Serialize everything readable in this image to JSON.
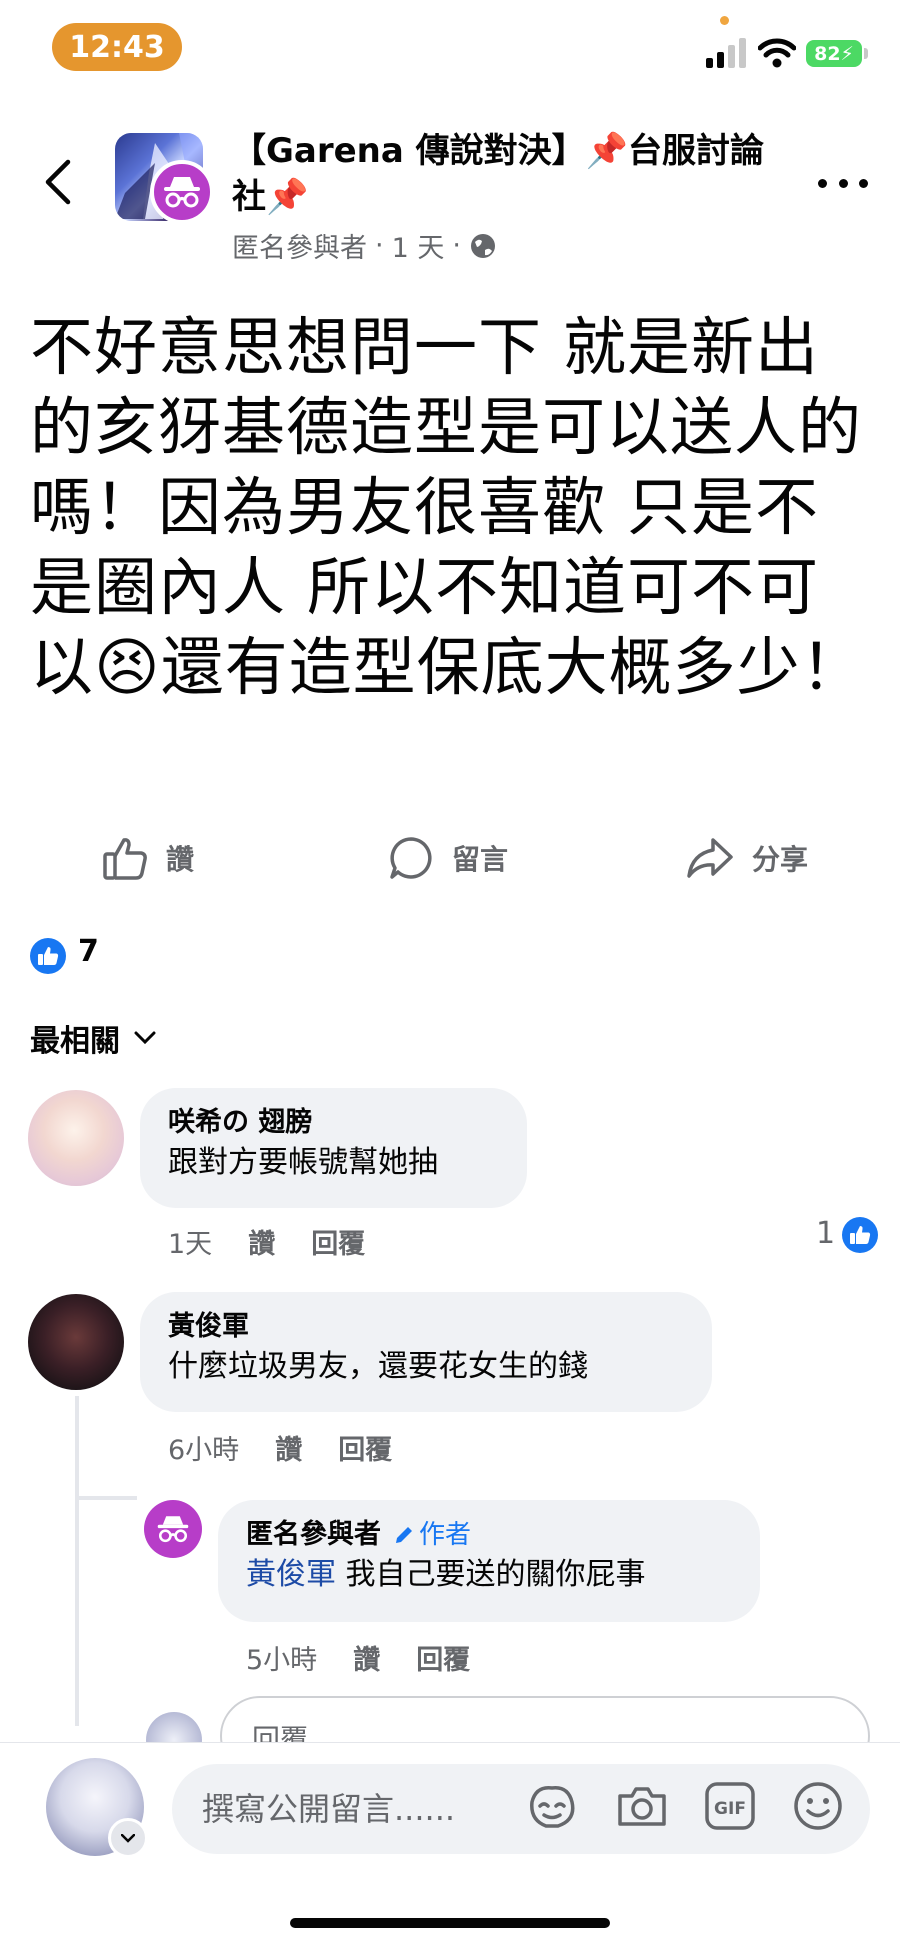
{
  "status_bar": {
    "time": "12:43",
    "battery": "82"
  },
  "header": {
    "group_name": "【Garena 傳說對決】📌台服討論社📌",
    "author": "匿名參與者",
    "time": "1 天"
  },
  "post": {
    "body": "不好意思想問一下 就是新出的亥犽基德造型是可以送人的嗎！因為男友很喜歡 只是不是圈內人 所以不知道可不可以😣還有造型保底大概多少！"
  },
  "actions": {
    "like": "讚",
    "comment": "留言",
    "share": "分享"
  },
  "reactions": {
    "count": "7"
  },
  "sort": {
    "label": "最相關"
  },
  "comments": [
    {
      "name": "咲希の 翅膀",
      "text": "跟對方要帳號幫她抽",
      "time": "1天",
      "like": "讚",
      "reply": "回覆",
      "like_count": "1"
    },
    {
      "name": "黃俊軍",
      "text": "什麼垃圾男友，還要花女生的錢",
      "time": "6小時",
      "like": "讚",
      "reply": "回覆"
    }
  ],
  "reply": {
    "name": "匿名參與者",
    "badge": "作者",
    "mention": "黃俊軍",
    "text": " 我自己要送的關你屁事",
    "time": "5小時",
    "like": "讚",
    "reply": "回覆"
  },
  "reply_box": {
    "placeholder": "回覆"
  },
  "composer": {
    "placeholder": "撰寫公開留言......"
  },
  "colors": {
    "accent": "#1877f2",
    "anon": "#b73dc8",
    "time_pill": "#e5962e",
    "battery": "#4cd964"
  }
}
